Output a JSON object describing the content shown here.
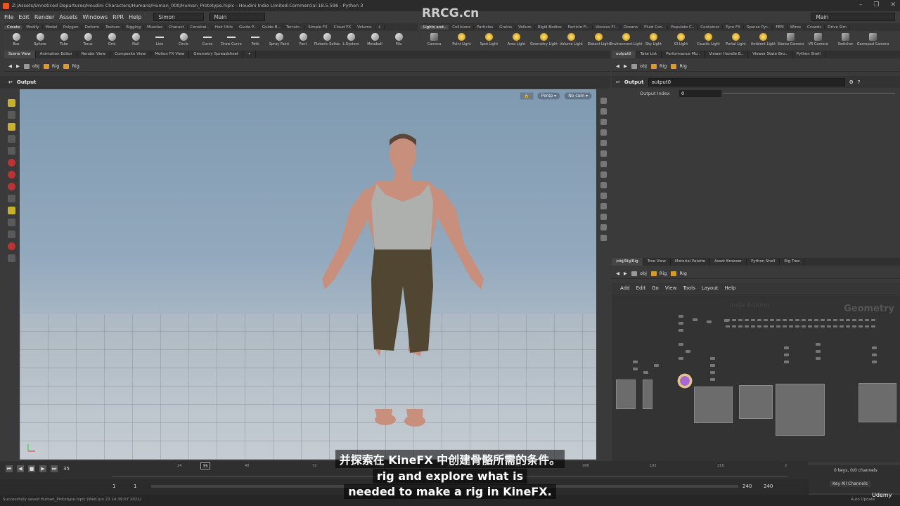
{
  "window": {
    "title": "Z:/Assets/Unnoticed Departures/Houdini Characters/Humans/Human_000/Human_Prototype.hiplc - Houdini Indie Limited-Commercial 18.5.596 - Python 3",
    "controls": [
      "–",
      "❐",
      "✕"
    ]
  },
  "menubar": {
    "items": [
      "File",
      "Edit",
      "Render",
      "Assets",
      "Windows",
      "RPR",
      "Help"
    ],
    "desktop": "Simon",
    "layout": "Main",
    "right_layout": "Main"
  },
  "shelf_left": {
    "tabs": [
      "Create",
      "Modify",
      "Model",
      "Polygon",
      "Deform",
      "Texture",
      "Rigging",
      "Muscles",
      "Charact",
      "Constrai..",
      "Hair Utils",
      "Guide P..",
      "Guide B..",
      "Terrain..",
      "Simple FX",
      "Cloud FX",
      "Volume",
      "+"
    ],
    "active_tab": "Create",
    "tools": [
      "Box",
      "Sphere",
      "Tube",
      "Torus",
      "Grid",
      "Null",
      "Line",
      "Circle",
      "Curve",
      "Draw Curve",
      "Path",
      "Spray Paint",
      "Font",
      "Platonic Solids",
      "L-System",
      "Metaball",
      "File"
    ]
  },
  "shelf_right": {
    "tabs": [
      "Lights and..",
      "Collisions",
      "Particles",
      "Grains",
      "Vellum",
      "Rigid Bodies",
      "Particle Fl..",
      "Viscous Fl..",
      "Oceans",
      "Fluid Con..",
      "Populate C..",
      "Container",
      "Pyro FX",
      "Sparse Pyr..",
      "FEM",
      "Wires",
      "Crowds",
      "Drive Sim"
    ],
    "active_tab": "Lights and..",
    "tools": [
      "Camera",
      "Point Light",
      "Spot Light",
      "Area Light",
      "Geometry Light",
      "Volume Light",
      "Distant Light",
      "Environment Light",
      "Sky Light",
      "GI Light",
      "Caustic Light",
      "Portal Light",
      "Ambient Light",
      "Stereo Camera",
      "VR Camera",
      "Switcher",
      "Gamepad Camera"
    ]
  },
  "left_pane": {
    "tabs": [
      "Scene View",
      "Animation Editor",
      "Render View",
      "Composite View",
      "Motion FX View",
      "Geometry Spreadsheet",
      "+"
    ],
    "path": [
      "obj",
      "Rig",
      "Rig"
    ],
    "header": "Output",
    "viewport": {
      "camera": "Persp ▾",
      "cam_menu": "No cam ▾"
    }
  },
  "right_top": {
    "tabs": [
      "output0",
      "Take List",
      "Performance Mo..",
      "Viewer Handle B..",
      "Viewer State Bro..",
      "Python Shell"
    ],
    "path": [
      "obj",
      "Rig",
      "Rig"
    ],
    "node_type": "Output",
    "node_name": "output0",
    "parm_label": "Output Index",
    "parm_value": "0"
  },
  "right_bottom": {
    "tabs": [
      "/obj/Rig/Rig",
      "Tree View",
      "Material Palette",
      "Asset Browser",
      "Python Shell",
      "Rig Tree"
    ],
    "path": [
      "obj",
      "Rig",
      "Rig"
    ],
    "menu": [
      "Add",
      "Edit",
      "Go",
      "View",
      "Tools",
      "Layout",
      "Help"
    ],
    "watermark": "Geometry",
    "sub_watermark": "Indie Edition"
  },
  "timeline": {
    "current_frame": "35",
    "marker_frame": "35",
    "ticks": [
      "24",
      "48",
      "72",
      "96",
      "120",
      "144",
      "168",
      "192",
      "216",
      "2"
    ],
    "start": "1",
    "start2": "1",
    "end": "240",
    "end2": "240",
    "keys_info": "0 keys, 0/0 channels",
    "key_all": "Key All Channels",
    "auto_update": "Auto Update"
  },
  "status": "Successfully saved Human_Prototype.hiplc (Wed Jun 23 14:39:07 2021)",
  "overlay": {
    "watermark": "RRCG.cn",
    "subtitle_cn": "并探索在 KineFX 中创建骨骼所需的条件。",
    "subtitle_en1": "rig and explore what is",
    "subtitle_en2": "needed to make a rig in KineFX.",
    "brand": "Udemy"
  },
  "colors": {
    "background": "#3a3a3a",
    "accent_orange": "#d99a2b",
    "sky_top": "#7f9ab1",
    "floor": "#c5ccd2"
  }
}
